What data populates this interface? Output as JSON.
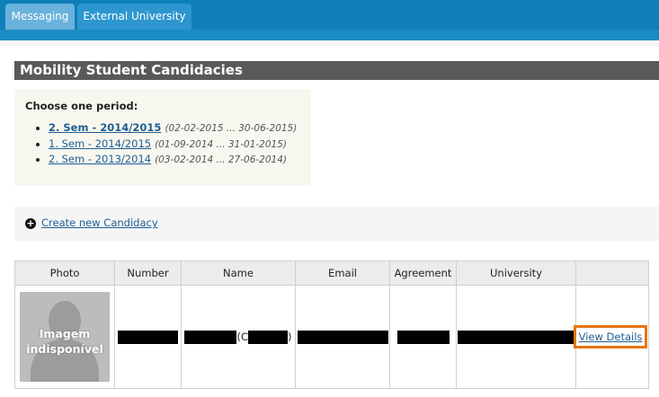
{
  "tabs": [
    {
      "label": "Messaging"
    },
    {
      "label": "External University"
    }
  ],
  "page_title": "Mobility Student Candidacies",
  "period": {
    "heading": "Choose one period:",
    "items": [
      {
        "label": "2. Sem - 2014/2015",
        "dates": "(02-02-2015 ... 30-06-2015)",
        "selected": true
      },
      {
        "label": "1. Sem - 2014/2015",
        "dates": "(01-09-2014 ... 31-01-2015)",
        "selected": false
      },
      {
        "label": "2. Sem - 2013/2014",
        "dates": "(03-02-2014 ... 27-06-2014)",
        "selected": false
      }
    ]
  },
  "create_candidacy": {
    "label": "Create new Candidacy",
    "icon": "plus-circle-icon"
  },
  "table": {
    "headers": [
      "Photo",
      "Number",
      "Name",
      "Email",
      "Agreement",
      "University",
      ""
    ],
    "rows": [
      {
        "photo_text": "Imagem indisponível",
        "name_open": "(C",
        "name_close": ")",
        "action": "View Details"
      }
    ]
  },
  "colors": {
    "topbar": "#0e7fb8",
    "title_bar": "#595959",
    "highlight": "#e87511",
    "link": "#1f5e93"
  }
}
